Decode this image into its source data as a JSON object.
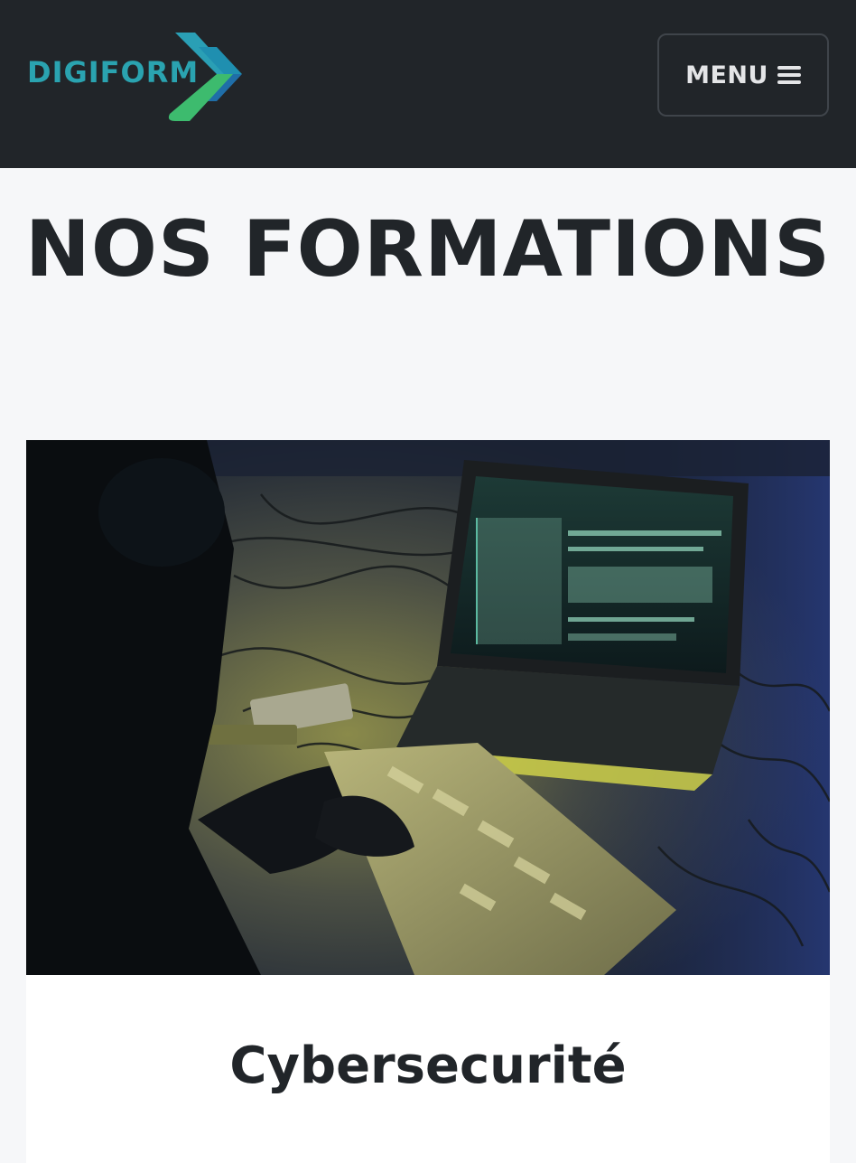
{
  "header": {
    "logo_text": "DIGIFORM",
    "menu_label": "MENU",
    "menu_icon": "hamburger-icon"
  },
  "main": {
    "title": "NOS FORMATIONS",
    "cards": [
      {
        "image": "hacker-laptop-photo",
        "title": "Cybersecurité"
      }
    ]
  },
  "colors": {
    "navbar": "#212529",
    "logo_text": "#2aa3b0",
    "logo_green": "#3dbb6e",
    "logo_teal": "#2a9fb5",
    "logo_blue": "#1f6ea8",
    "title": "#212529",
    "background": "#f6f7f9"
  }
}
